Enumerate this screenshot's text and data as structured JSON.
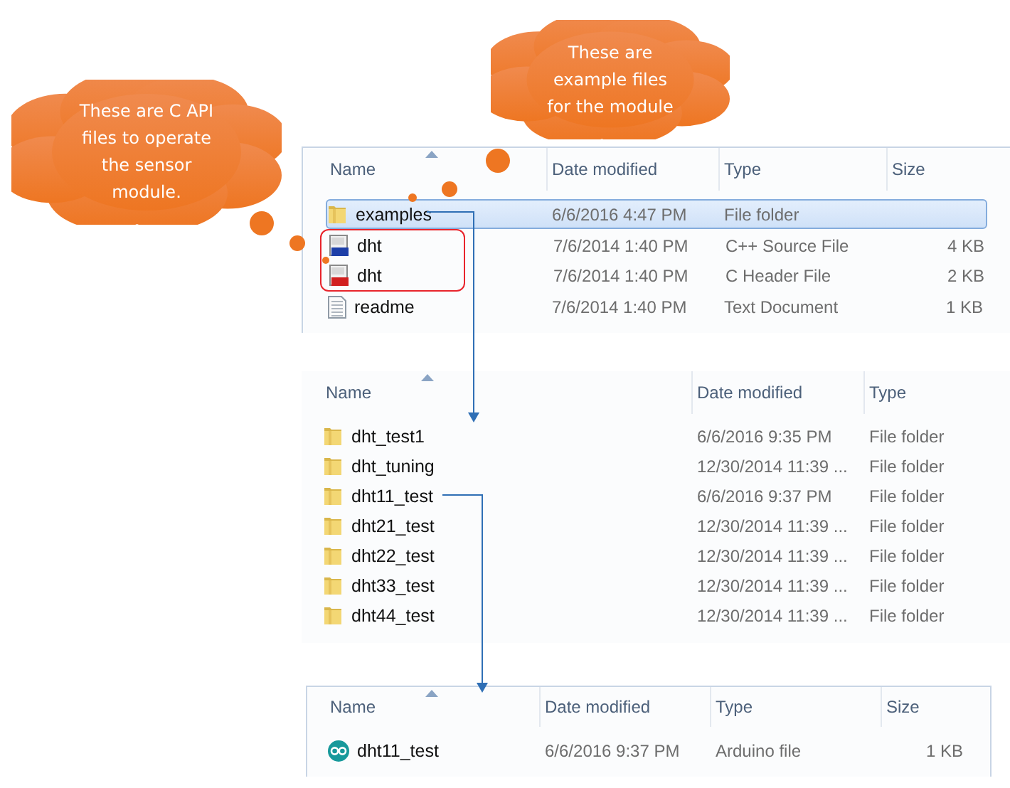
{
  "callouts": [
    {
      "text": "These are C API files to operate the sensor module."
    },
    {
      "text": "These are example files for the module"
    }
  ],
  "panels": [
    {
      "columns": [
        "Name",
        "Date modified",
        "Type",
        "Size"
      ],
      "rows": [
        {
          "kind": "folder",
          "name": "examples",
          "date": "6/6/2016 4:47 PM",
          "type": "File folder",
          "selected": true,
          "circled": false
        },
        {
          "kind": "cpp",
          "name": "dht",
          "date": "7/6/2014 1:40 PM",
          "type": "C++ Source File",
          "size": "4 KB",
          "selected": false,
          "circled": true
        },
        {
          "kind": "header",
          "name": "dht",
          "date": "7/6/2014 1:40 PM",
          "type": "C Header File",
          "size": "2 KB",
          "selected": false,
          "circled": true
        },
        {
          "kind": "text",
          "name": "readme",
          "date": "7/6/2014 1:40 PM",
          "type": "Text Document",
          "size": "1 KB",
          "selected": false,
          "circled": false
        }
      ]
    },
    {
      "columns": [
        "Name",
        "Date modified",
        "Type"
      ],
      "rows": [
        {
          "kind": "folder",
          "name": "dht_test1",
          "date": "6/6/2016 9:35 PM",
          "type": "File folder",
          "selected": false,
          "circled": false
        },
        {
          "kind": "folder",
          "name": "dht_tuning",
          "date": "12/30/2014 11:39 ...",
          "type": "File folder",
          "selected": false,
          "circled": false
        },
        {
          "kind": "folder",
          "name": "dht11_test",
          "date": "6/6/2016 9:37 PM",
          "type": "File folder",
          "selected": false,
          "circled": false
        },
        {
          "kind": "folder",
          "name": "dht21_test",
          "date": "12/30/2014 11:39 ...",
          "type": "File folder",
          "selected": false,
          "circled": false
        },
        {
          "kind": "folder",
          "name": "dht22_test",
          "date": "12/30/2014 11:39 ...",
          "type": "File folder",
          "selected": false,
          "circled": false
        },
        {
          "kind": "folder",
          "name": "dht33_test",
          "date": "12/30/2014 11:39 ...",
          "type": "File folder",
          "selected": false,
          "circled": false
        },
        {
          "kind": "folder",
          "name": "dht44_test",
          "date": "12/30/2014 11:39 ...",
          "type": "File folder",
          "selected": false,
          "circled": false
        }
      ]
    },
    {
      "columns": [
        "Name",
        "Date modified",
        "Type",
        "Size"
      ],
      "rows": [
        {
          "kind": "arduino",
          "name": "dht11_test",
          "date": "6/6/2016 9:37 PM",
          "type": "Arduino file",
          "size": "1 KB",
          "selected": false,
          "circled": false
        }
      ]
    }
  ]
}
